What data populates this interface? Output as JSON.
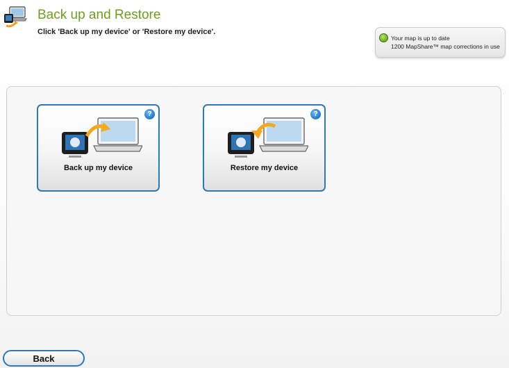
{
  "header": {
    "title": "Back up and Restore",
    "subtitle": "Click 'Back up my device' or 'Restore my device'.",
    "icon": "backup-restore-icon"
  },
  "status": {
    "line1": "Your map is up to date",
    "line2": "1200 MapShare™ map corrections in use",
    "dot_color": "#6fae1e"
  },
  "tiles": [
    {
      "label": "Back up my device",
      "icon": "device-to-laptop-icon",
      "help": "?"
    },
    {
      "label": "Restore my device",
      "icon": "laptop-to-device-icon",
      "help": "?"
    }
  ],
  "footer": {
    "back_label": "Back"
  },
  "colors": {
    "title_green": "#6e9e1e",
    "accent_blue": "#2e78b5"
  }
}
